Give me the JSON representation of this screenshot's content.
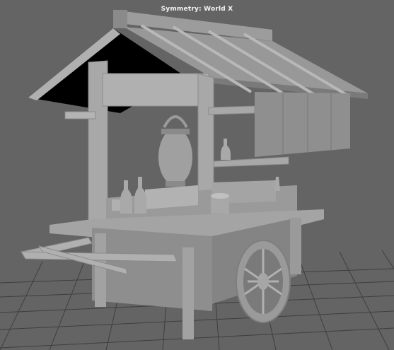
{
  "viewport": {
    "hud": {
      "symmetry_label": "Symmetry: World X"
    },
    "colors": {
      "background": "#646464",
      "grid": "#3a3a3a",
      "model_light": "#a6a6a6",
      "model_mid": "#8c8c8c",
      "model_dark": "#6e6e6e",
      "roof_underside": "#000000"
    },
    "scene": "3D model of a wooden food cart (yatai) with roof, lantern, bottles and wheel"
  }
}
